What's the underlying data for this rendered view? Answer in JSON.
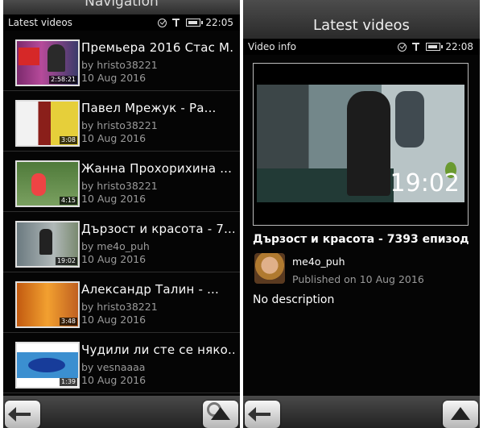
{
  "left": {
    "banner": "Navigation",
    "status": {
      "title": "Latest videos",
      "time": "22:05"
    },
    "videos": [
      {
        "title": "Премьера 2016 Стас М...",
        "uploader": "by hristo38221",
        "date": "10 Aug 2016",
        "duration": "2:58:21"
      },
      {
        "title": "Павел Мрежук - Ра...",
        "uploader": "by hristo38221",
        "date": "10 Aug 2016",
        "duration": "3:08"
      },
      {
        "title": "Жанна Прохорихина ...",
        "uploader": "by hristo38221",
        "date": "10 Aug 2016",
        "duration": "4:15"
      },
      {
        "title": "Дързост и красота - 7...",
        "uploader": "by me4o_puh",
        "date": "10 Aug 2016",
        "duration": "19:02"
      },
      {
        "title": "Александр Талин - ...",
        "uploader": "by hristo38221",
        "date": "10 Aug 2016",
        "duration": "3:48"
      },
      {
        "title": "Чудили ли сте се няко...",
        "uploader": "by vesnaaaa",
        "date": "10 Aug 2016",
        "duration": "1:39"
      }
    ]
  },
  "right": {
    "banner": "Latest videos",
    "status": {
      "title": "Video info",
      "time": "22:08"
    },
    "video": {
      "duration": "19:02",
      "title": "Дързост и красота - 7393 епизод",
      "uploader": "me4o_puh",
      "published": "Published on 10 Aug 2016",
      "description": "No description"
    }
  },
  "icons": {
    "status": [
      "sync-icon",
      "signal-icon",
      "battery-icon"
    ],
    "toolbar": [
      "back-arrow-icon",
      "search-icon",
      "arrow-up-icon"
    ]
  }
}
